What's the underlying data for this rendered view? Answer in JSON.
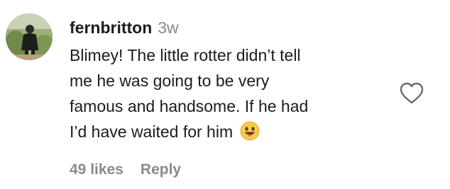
{
  "comment": {
    "username": "fernbritton",
    "age": "3w",
    "text_lines": [
      "Blimey! The little rotter didn’t tell",
      "me he was going to be very",
      "famous and handsome. If he had",
      "I’d have waited for him"
    ],
    "emoji": "grinning-face-with-tongue",
    "likes": "49 likes",
    "reply": "Reply"
  },
  "icons": {
    "like": "heart-outline-icon"
  }
}
